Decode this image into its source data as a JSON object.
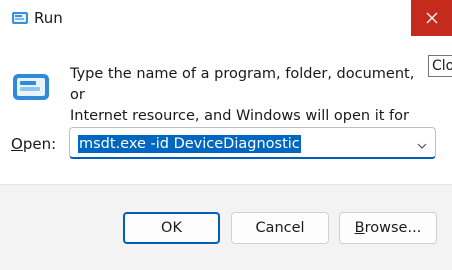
{
  "window": {
    "title": "Run",
    "close_icon": "close-icon",
    "close_color": "#c42b1c"
  },
  "tooltip": {
    "text": "Clo"
  },
  "body": {
    "icon": "run-icon",
    "description_line1": "Type the name of a program, folder, document, or",
    "description_line2": "Internet resource, and Windows will open it for you."
  },
  "open_field": {
    "label_accelerator": "O",
    "label_rest": "pen:",
    "value": "msdt.exe -id DeviceDiagnostic",
    "selection_color": "#0067c0",
    "dropdown_icon": "chevron-down-icon"
  },
  "buttons": {
    "ok_label": "OK",
    "cancel_label": "Cancel",
    "browse_accelerator": "B",
    "browse_rest": "rowse...",
    "accent_color": "#005fb8"
  }
}
